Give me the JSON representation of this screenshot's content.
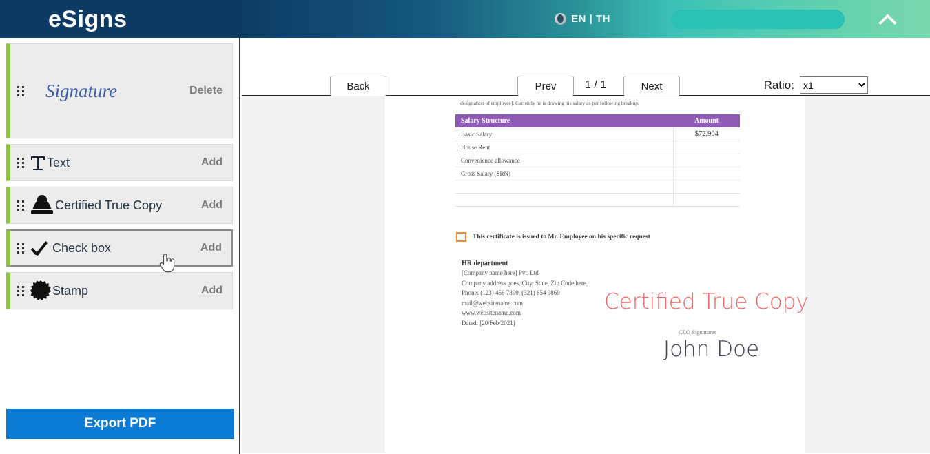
{
  "header": {
    "brand": "eSigns",
    "globe_icon": "globe-icon",
    "language": "EN | TH",
    "collapse_icon": "chevron-up-icon",
    "accent_navy": "#0c3a63",
    "accent_teal": "#29c0b5",
    "accent_mint": "#79d8ab"
  },
  "sidebar": {
    "accent_green": "#8cc63f",
    "items": [
      {
        "label": "Signature",
        "action": "Delete",
        "icon": "drag-handle-icon",
        "type": "signature"
      },
      {
        "label": "Text",
        "action": "Add",
        "icon": "text-icon",
        "type": "text"
      },
      {
        "label": "Certified True Copy",
        "action": "Add",
        "icon": "stamp-icon",
        "type": "ctc"
      },
      {
        "label": "Check box",
        "action": "Add",
        "icon": "check-icon",
        "type": "checkbox"
      },
      {
        "label": "Stamp",
        "action": "Add",
        "icon": "seal-icon",
        "type": "stamp"
      }
    ],
    "export_button": "Export PDF",
    "export_color": "#0b7bd4"
  },
  "toolbar": {
    "back": "Back",
    "prev": "Prev",
    "page_indicator": "1 / 1",
    "next": "Next",
    "ratio_label": "Ratio:",
    "ratio_value": "x1",
    "ratio_options": [
      "x1"
    ]
  },
  "document": {
    "intro_line": "designation of employee]. Currently he is drawing his salary as per following breakup.",
    "table": {
      "header_color": "#8e5ab4",
      "columns": [
        "Salary  Structure",
        "Amount"
      ],
      "rows": [
        {
          "item": "Basic Salary",
          "amount": "$72,904"
        },
        {
          "item": "House Rent",
          "amount": ""
        },
        {
          "item": "Convenience allowance",
          "amount": ""
        },
        {
          "item": "Gross Salary  (SRN)",
          "amount": ""
        },
        {
          "item": "",
          "amount": ""
        },
        {
          "item": "",
          "amount": ""
        }
      ]
    },
    "checkbox_note": "This certificate is issued to Mr. Employee on his specific request",
    "checkbox_color": "#f08b33",
    "hr": {
      "title": "HR department",
      "lines": [
        "[Company name here] Pvt. Ltd",
        "Company address goes, City, State, Zip Code  here,",
        "Phone: (123) 456 7890,  (321) 654 9869",
        "mail@websitename.com",
        "www.websitename.com",
        "Dated: [20/Feb/2021]"
      ]
    },
    "certified_stamp": "Certified True Copy",
    "certified_stamp_color": "#fc6464",
    "ceo_caption": "CEO Signatures",
    "signature_name": "John Doe"
  },
  "cursor": {
    "type": "pointing-hand-cursor"
  }
}
